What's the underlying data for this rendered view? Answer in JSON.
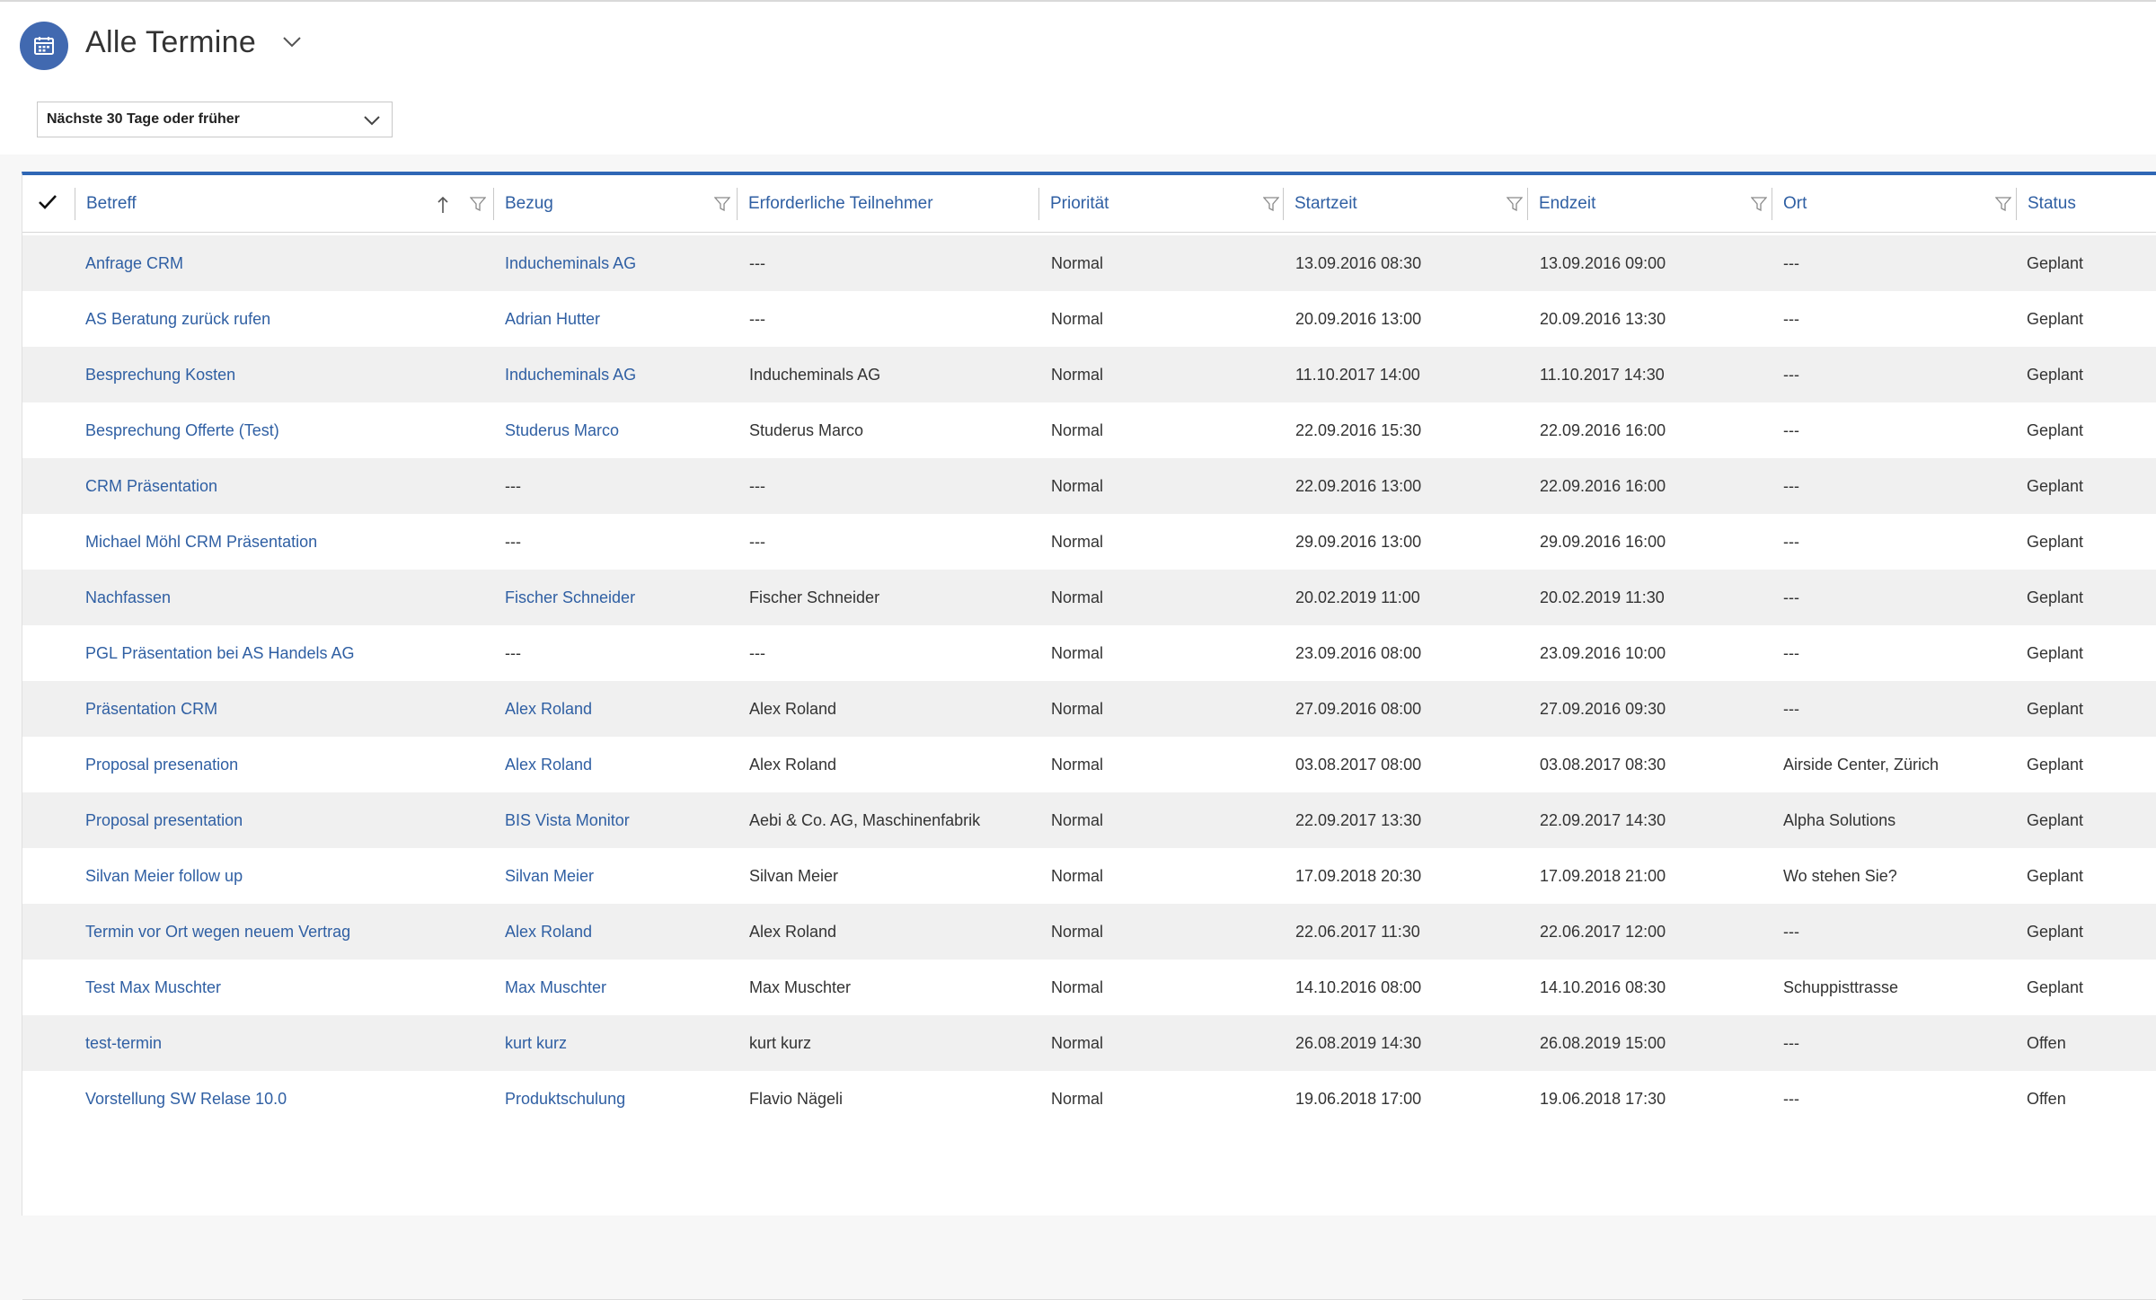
{
  "view": {
    "title": "Alle Termine",
    "filter_value": "Nächste 30 Tage oder früher",
    "icon": "calendar-icon",
    "accent": "#4169b0"
  },
  "columns": {
    "betreff": "Betreff",
    "bezug": "Bezug",
    "teilnehmer": "Erforderliche Teilnehmer",
    "prioritaet": "Priorität",
    "startzeit": "Startzeit",
    "endzeit": "Endzeit",
    "ort": "Ort",
    "status": "Status"
  },
  "rows": [
    {
      "betreff": "Anfrage CRM",
      "bezug": "Inducheminals AG",
      "teilnehmer": "---",
      "prioritaet": "Normal",
      "startzeit": "13.09.2016 08:30",
      "endzeit": "13.09.2016 09:00",
      "ort": "---",
      "status": "Geplant"
    },
    {
      "betreff": "AS Beratung zurück rufen",
      "bezug": "Adrian Hutter",
      "teilnehmer": "---",
      "prioritaet": "Normal",
      "startzeit": "20.09.2016 13:00",
      "endzeit": "20.09.2016 13:30",
      "ort": "---",
      "status": "Geplant"
    },
    {
      "betreff": "Besprechung Kosten",
      "bezug": "Inducheminals AG",
      "teilnehmer": "Inducheminals AG",
      "prioritaet": "Normal",
      "startzeit": "11.10.2017 14:00",
      "endzeit": "11.10.2017 14:30",
      "ort": "---",
      "status": "Geplant"
    },
    {
      "betreff": "Besprechung Offerte (Test)",
      "bezug": "Studerus Marco",
      "teilnehmer": "Studerus Marco",
      "prioritaet": "Normal",
      "startzeit": "22.09.2016 15:30",
      "endzeit": "22.09.2016 16:00",
      "ort": "---",
      "status": "Geplant"
    },
    {
      "betreff": "CRM Präsentation",
      "bezug": "---",
      "teilnehmer": "---",
      "prioritaet": "Normal",
      "startzeit": "22.09.2016 13:00",
      "endzeit": "22.09.2016 16:00",
      "ort": "---",
      "status": "Geplant"
    },
    {
      "betreff": "Michael Möhl CRM Präsentation",
      "bezug": "---",
      "teilnehmer": "---",
      "prioritaet": "Normal",
      "startzeit": "29.09.2016 13:00",
      "endzeit": "29.09.2016 16:00",
      "ort": "---",
      "status": "Geplant"
    },
    {
      "betreff": "Nachfassen",
      "bezug": "Fischer Schneider",
      "teilnehmer": "Fischer Schneider",
      "prioritaet": "Normal",
      "startzeit": "20.02.2019 11:00",
      "endzeit": "20.02.2019 11:30",
      "ort": "---",
      "status": "Geplant"
    },
    {
      "betreff": "PGL Präsentation bei AS Handels AG",
      "bezug": "---",
      "teilnehmer": "---",
      "prioritaet": "Normal",
      "startzeit": "23.09.2016 08:00",
      "endzeit": "23.09.2016 10:00",
      "ort": "---",
      "status": "Geplant"
    },
    {
      "betreff": "Präsentation CRM",
      "bezug": "Alex Roland",
      "teilnehmer": "Alex Roland",
      "prioritaet": "Normal",
      "startzeit": "27.09.2016 08:00",
      "endzeit": "27.09.2016 09:30",
      "ort": "---",
      "status": "Geplant"
    },
    {
      "betreff": "Proposal presenation",
      "bezug": "Alex Roland",
      "teilnehmer": "Alex Roland",
      "prioritaet": "Normal",
      "startzeit": "03.08.2017 08:00",
      "endzeit": "03.08.2017 08:30",
      "ort": "Airside Center, Zürich",
      "status": "Geplant"
    },
    {
      "betreff": "Proposal presentation",
      "bezug": "BIS Vista Monitor",
      "teilnehmer": "Aebi & Co. AG, Maschinenfabrik",
      "prioritaet": "Normal",
      "startzeit": "22.09.2017 13:30",
      "endzeit": "22.09.2017 14:30",
      "ort": "Alpha Solutions",
      "status": "Geplant"
    },
    {
      "betreff": "Silvan Meier follow up",
      "bezug": "Silvan Meier",
      "teilnehmer": "Silvan Meier",
      "prioritaet": "Normal",
      "startzeit": "17.09.2018 20:30",
      "endzeit": "17.09.2018 21:00",
      "ort": "Wo stehen Sie?",
      "status": "Geplant"
    },
    {
      "betreff": "Termin vor Ort wegen neuem Vertrag",
      "bezug": "Alex Roland",
      "teilnehmer": "Alex Roland",
      "prioritaet": "Normal",
      "startzeit": "22.06.2017 11:30",
      "endzeit": "22.06.2017 12:00",
      "ort": "---",
      "status": "Geplant"
    },
    {
      "betreff": "Test Max Muschter",
      "bezug": "Max Muschter",
      "teilnehmer": "Max Muschter",
      "prioritaet": "Normal",
      "startzeit": "14.10.2016 08:00",
      "endzeit": "14.10.2016 08:30",
      "ort": "Schuppisttrasse",
      "status": "Geplant"
    },
    {
      "betreff": "test-termin",
      "bezug": "kurt kurz",
      "teilnehmer": "kurt kurz",
      "prioritaet": "Normal",
      "startzeit": "26.08.2019 14:30",
      "endzeit": "26.08.2019 15:00",
      "ort": "---",
      "status": "Offen"
    },
    {
      "betreff": "Vorstellung SW Relase 10.0",
      "bezug": "Produktschulung",
      "teilnehmer": "Flavio Nägeli",
      "prioritaet": "Normal",
      "startzeit": "19.06.2018 17:00",
      "endzeit": "19.06.2018 17:30",
      "ort": "---",
      "status": "Offen"
    }
  ]
}
